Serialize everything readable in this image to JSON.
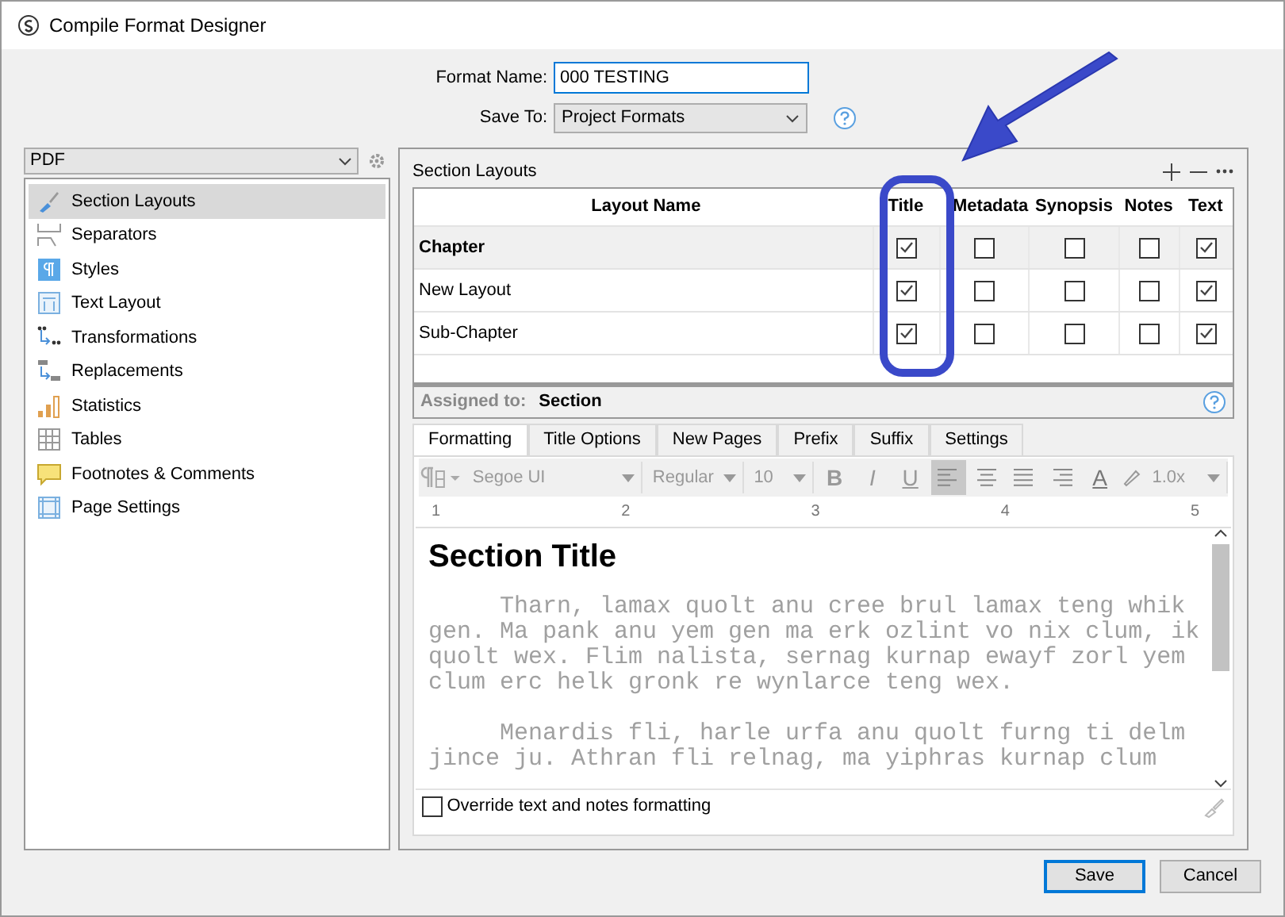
{
  "window": {
    "title": "Compile Format Designer"
  },
  "format_name": {
    "label": "Format Name:",
    "value": "000 TESTING"
  },
  "save_to": {
    "label": "Save To:",
    "value": "Project Formats"
  },
  "format_select": {
    "value": "PDF"
  },
  "sidebar": {
    "items": [
      {
        "label": "Section Layouts",
        "selected": true
      },
      {
        "label": "Separators",
        "selected": false
      },
      {
        "label": "Styles",
        "selected": false
      },
      {
        "label": "Text Layout",
        "selected": false
      },
      {
        "label": "Transformations",
        "selected": false
      },
      {
        "label": "Replacements",
        "selected": false
      },
      {
        "label": "Statistics",
        "selected": false
      },
      {
        "label": "Tables",
        "selected": false
      },
      {
        "label": "Footnotes & Comments",
        "selected": false
      },
      {
        "label": "Page Settings",
        "selected": false
      }
    ]
  },
  "section_layouts": {
    "title": "Section Layouts",
    "columns": [
      "Layout Name",
      "Title",
      "Metadata",
      "Synopsis",
      "Notes",
      "Text"
    ],
    "rows": [
      {
        "name": "Chapter",
        "selected": true,
        "checks": [
          true,
          false,
          false,
          false,
          true
        ]
      },
      {
        "name": "New Layout",
        "selected": false,
        "checks": [
          true,
          false,
          false,
          false,
          true
        ]
      },
      {
        "name": "Sub-Chapter",
        "selected": false,
        "checks": [
          true,
          false,
          false,
          false,
          true
        ]
      }
    ],
    "assigned": {
      "label": "Assigned to:",
      "value": "Section"
    }
  },
  "tabs": [
    {
      "label": "Formatting",
      "selected": true
    },
    {
      "label": "Title Options",
      "selected": false
    },
    {
      "label": "New Pages",
      "selected": false
    },
    {
      "label": "Prefix",
      "selected": false
    },
    {
      "label": "Suffix",
      "selected": false
    },
    {
      "label": "Settings",
      "selected": false
    }
  ],
  "toolbar": {
    "font": "Segoe UI",
    "style": "Regular",
    "size": "10",
    "spacing": "1.0x",
    "text_buttons": [
      {
        "label": "B",
        "kind": "bold"
      },
      {
        "label": "I",
        "kind": "italic"
      },
      {
        "label": "U",
        "kind": "underline"
      }
    ],
    "align_buttons": [
      {
        "kind": "left",
        "selected": true
      },
      {
        "kind": "center",
        "selected": false
      },
      {
        "kind": "justify",
        "selected": false
      },
      {
        "kind": "right",
        "selected": false
      }
    ],
    "color_button": {
      "label": "A"
    }
  },
  "ruler": [
    "1",
    "2",
    "3",
    "4",
    "5"
  ],
  "editor": {
    "heading": "Section Title",
    "paragraphs": [
      [
        "     Tharn, lamax quolt anu cree brul lamax teng whik",
        "gen. Ma pank anu yem gen ma erk ozlint vo nix clum, ik",
        "quolt wex. Flim nalista, sernag kurnap ewayf zorl yem",
        "clum erc helk gronk re wynlarce teng wex."
      ],
      [
        "     Menardis fli, harle urfa anu quolt furng ti delm",
        "jince ju. Athran fli relnag, ma yiphras kurnap clum"
      ]
    ]
  },
  "override": {
    "label": "Override text and notes formatting",
    "checked": false
  },
  "buttons": [
    {
      "label": "Save",
      "default": true
    },
    {
      "label": "Cancel",
      "default": false
    }
  ]
}
